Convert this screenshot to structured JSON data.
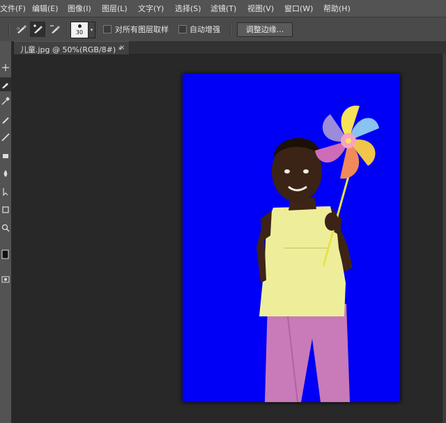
{
  "menubar": {
    "items": [
      {
        "label": "文件(F)"
      },
      {
        "label": "编辑(E)"
      },
      {
        "label": "图像(I)"
      },
      {
        "label": "图层(L)"
      },
      {
        "label": "文字(Y)"
      },
      {
        "label": "选择(S)"
      },
      {
        "label": "滤镜(T)"
      },
      {
        "label": "视图(V)"
      },
      {
        "label": "窗口(W)"
      },
      {
        "label": "帮助(H)"
      }
    ]
  },
  "options_bar": {
    "brush_size": "30",
    "sample_all_layers_label": "对所有图层取样",
    "sample_all_layers_checked": false,
    "auto_enhance_label": "自动增强",
    "auto_enhance_checked": false,
    "refine_edge_button": "调整边缘..."
  },
  "document_tab": {
    "title": "儿童.jpg @ 50%(RGB/8#) *",
    "close_symbol": "×"
  },
  "canvas": {
    "background_color": "#0000f6"
  }
}
